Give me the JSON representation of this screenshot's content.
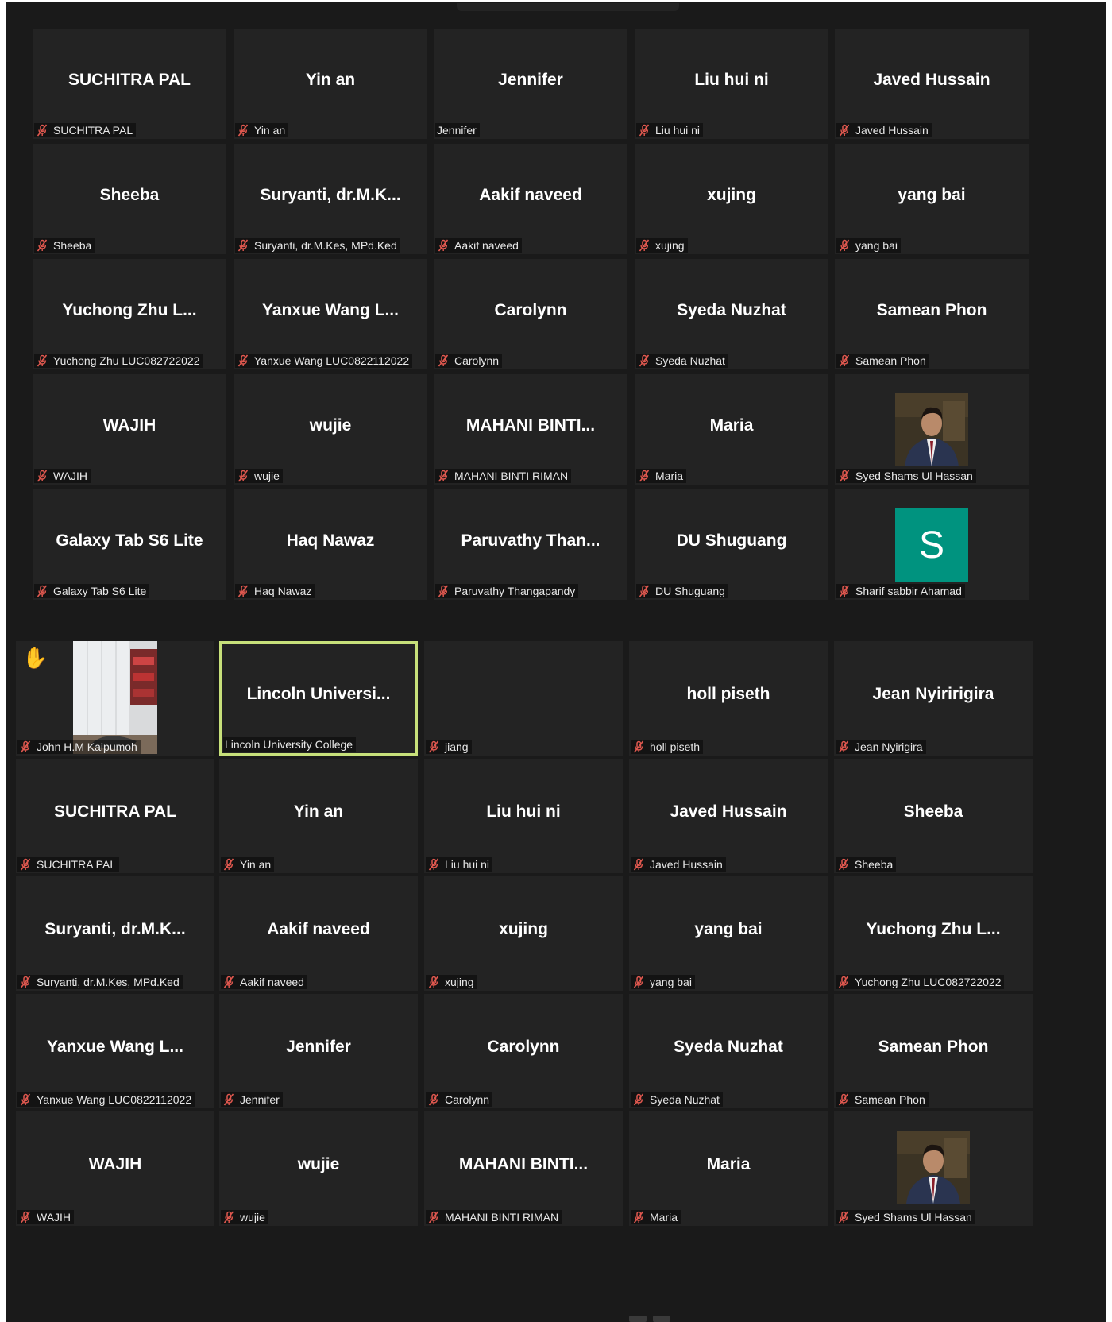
{
  "grid_top": [
    {
      "big": "SUCHITRA PAL",
      "label": "SUCHITRA PAL",
      "muted": true
    },
    {
      "big": "Yin an",
      "label": "Yin an",
      "muted": true
    },
    {
      "big": "Jennifer",
      "label": "Jennifer",
      "muted": false
    },
    {
      "big": "Liu hui ni",
      "label": "Liu hui ni",
      "muted": true
    },
    {
      "big": "Javed Hussain",
      "label": "Javed Hussain",
      "muted": true
    },
    {
      "big": "Sheeba",
      "label": "Sheeba",
      "muted": true
    },
    {
      "big": "Suryanti,  dr.M.K...",
      "label": "Suryanti, dr.M.Kes, MPd.Ked",
      "muted": true
    },
    {
      "big": "Aakif naveed",
      "label": "Aakif naveed",
      "muted": true
    },
    {
      "big": "xujing",
      "label": "xujing",
      "muted": true
    },
    {
      "big": "yang bai",
      "label": "yang bai",
      "muted": true
    },
    {
      "big": "Yuchong Zhu L...",
      "label": "Yuchong Zhu LUC082722022",
      "muted": true
    },
    {
      "big": "Yanxue Wang L...",
      "label": "Yanxue Wang LUC0822112022",
      "muted": true
    },
    {
      "big": "Carolynn",
      "label": "Carolynn",
      "muted": true
    },
    {
      "big": "Syeda Nuzhat",
      "label": "Syeda Nuzhat",
      "muted": true
    },
    {
      "big": "Samean Phon",
      "label": "Samean Phon",
      "muted": true
    },
    {
      "big": "WAJIH",
      "label": "WAJIH",
      "muted": true
    },
    {
      "big": "wujie",
      "label": "wujie",
      "muted": true
    },
    {
      "big": "MAHANI  BINTI...",
      "label": "MAHANI BINTI RIMAN",
      "muted": true
    },
    {
      "big": "Maria",
      "label": "Maria",
      "muted": true
    },
    {
      "big": "",
      "label": "Syed Shams Ul Hassan",
      "muted": true,
      "media": "photo"
    },
    {
      "big": "Galaxy Tab S6 Lite",
      "label": "Galaxy Tab S6 Lite",
      "muted": true
    },
    {
      "big": "Haq Nawaz",
      "label": "Haq Nawaz",
      "muted": true
    },
    {
      "big": "Paruvathy  Than...",
      "label": "Paruvathy Thangapandy",
      "muted": true
    },
    {
      "big": "DU Shuguang",
      "label": "DU Shuguang",
      "muted": true
    },
    {
      "big": "",
      "label": "Sharif sabbir Ahamad",
      "muted": true,
      "media": "avatar",
      "avatar_letter": "S",
      "avatar_color": "#00937f"
    }
  ],
  "grid_bottom": [
    {
      "big": "",
      "label": "John H.M Kaipumoh",
      "muted": true,
      "media": "room",
      "hand": "✋"
    },
    {
      "big": "Lincoln  Universi...",
      "label": "Lincoln University College",
      "muted": false,
      "active": true
    },
    {
      "big": "",
      "label": "jiang",
      "muted": true
    },
    {
      "big": "holl piseth",
      "label": "holl piseth",
      "muted": true
    },
    {
      "big": "Jean Nyiririgira",
      "label": "Jean Nyirigira",
      "muted": true
    },
    {
      "big": "SUCHITRA PAL",
      "label": "SUCHITRA PAL",
      "muted": true
    },
    {
      "big": "Yin an",
      "label": "Yin an",
      "muted": true
    },
    {
      "big": "Liu hui ni",
      "label": "Liu hui ni",
      "muted": true
    },
    {
      "big": "Javed Hussain",
      "label": "Javed Hussain",
      "muted": true
    },
    {
      "big": "Sheeba",
      "label": "Sheeba",
      "muted": true
    },
    {
      "big": "Suryanti,  dr.M.K...",
      "label": "Suryanti, dr.M.Kes, MPd.Ked",
      "muted": true
    },
    {
      "big": "Aakif naveed",
      "label": "Aakif naveed",
      "muted": true
    },
    {
      "big": "xujing",
      "label": "xujing",
      "muted": true
    },
    {
      "big": "yang bai",
      "label": "yang bai",
      "muted": true
    },
    {
      "big": "Yuchong Zhu L...",
      "label": "Yuchong Zhu LUC082722022",
      "muted": true
    },
    {
      "big": "Yanxue Wang L...",
      "label": "Yanxue Wang LUC0822112022",
      "muted": true
    },
    {
      "big": "Jennifer",
      "label": "Jennifer",
      "muted": true
    },
    {
      "big": "Carolynn",
      "label": "Carolynn",
      "muted": true
    },
    {
      "big": "Syeda Nuzhat",
      "label": "Syeda Nuzhat",
      "muted": true
    },
    {
      "big": "Samean Phon",
      "label": "Samean Phon",
      "muted": true
    },
    {
      "big": "WAJIH",
      "label": "WAJIH",
      "muted": true
    },
    {
      "big": "wujie",
      "label": "wujie",
      "muted": true
    },
    {
      "big": "MAHANI  BINTI...",
      "label": "MAHANI BINTI RIMAN",
      "muted": true
    },
    {
      "big": "Maria",
      "label": "Maria",
      "muted": true
    },
    {
      "big": "",
      "label": "Syed Shams Ul Hassan",
      "muted": true,
      "media": "photo"
    }
  ],
  "colors": {
    "tile": "#232323",
    "active_border": "#c7e07a",
    "mic_muted": "#e0584f"
  },
  "icons": {
    "mic_muted": "mic-muted-icon",
    "raise_hand": "raise-hand-icon"
  }
}
